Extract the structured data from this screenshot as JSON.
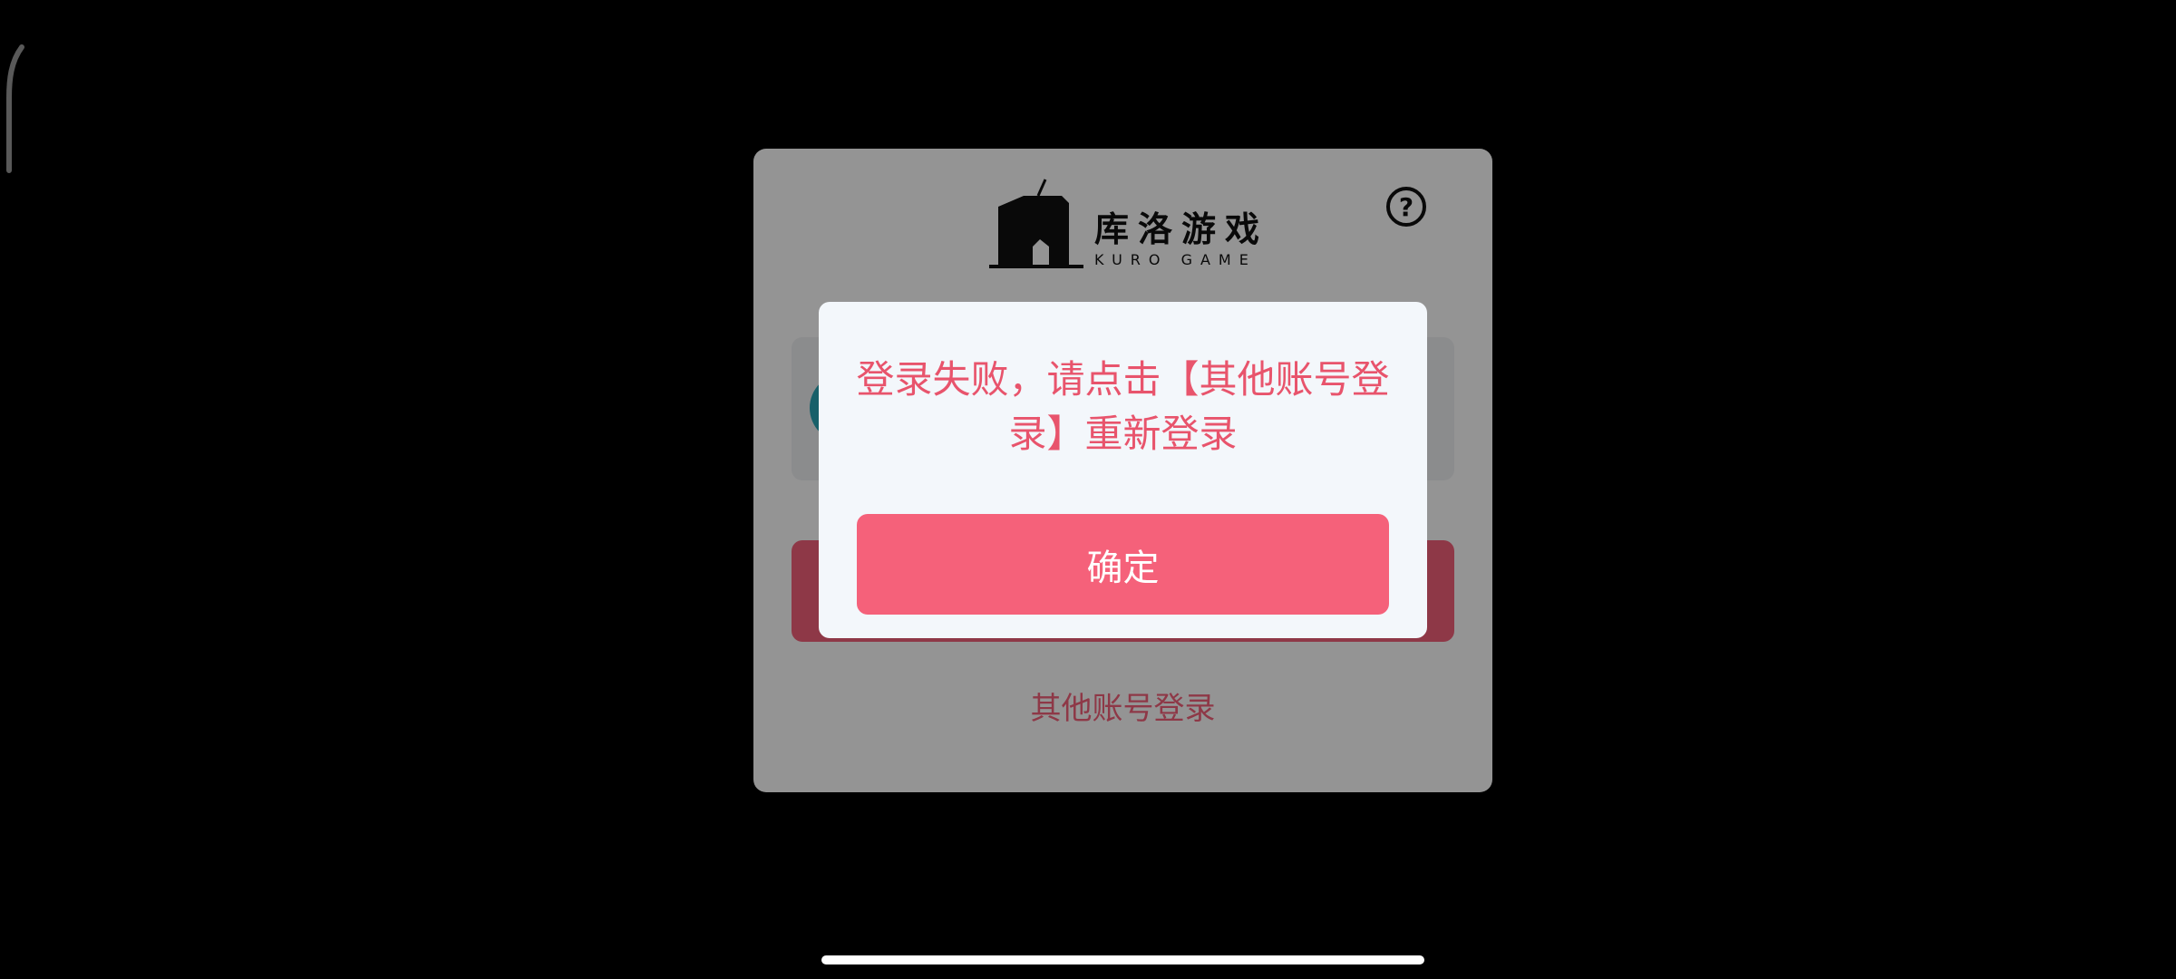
{
  "login_panel": {
    "logo_text_cn": "库洛游戏",
    "logo_text_en": "KURO GAME",
    "help_icon": "question-circle-icon",
    "other_login_label": "其他账号登录"
  },
  "dialog": {
    "message": "登录失败，请点击【其他账号登录】重新登录",
    "confirm_label": "确定"
  },
  "colors": {
    "accent": "#F5617A",
    "dialog_bg": "#F3F7FB",
    "message_text": "#E8546C"
  }
}
